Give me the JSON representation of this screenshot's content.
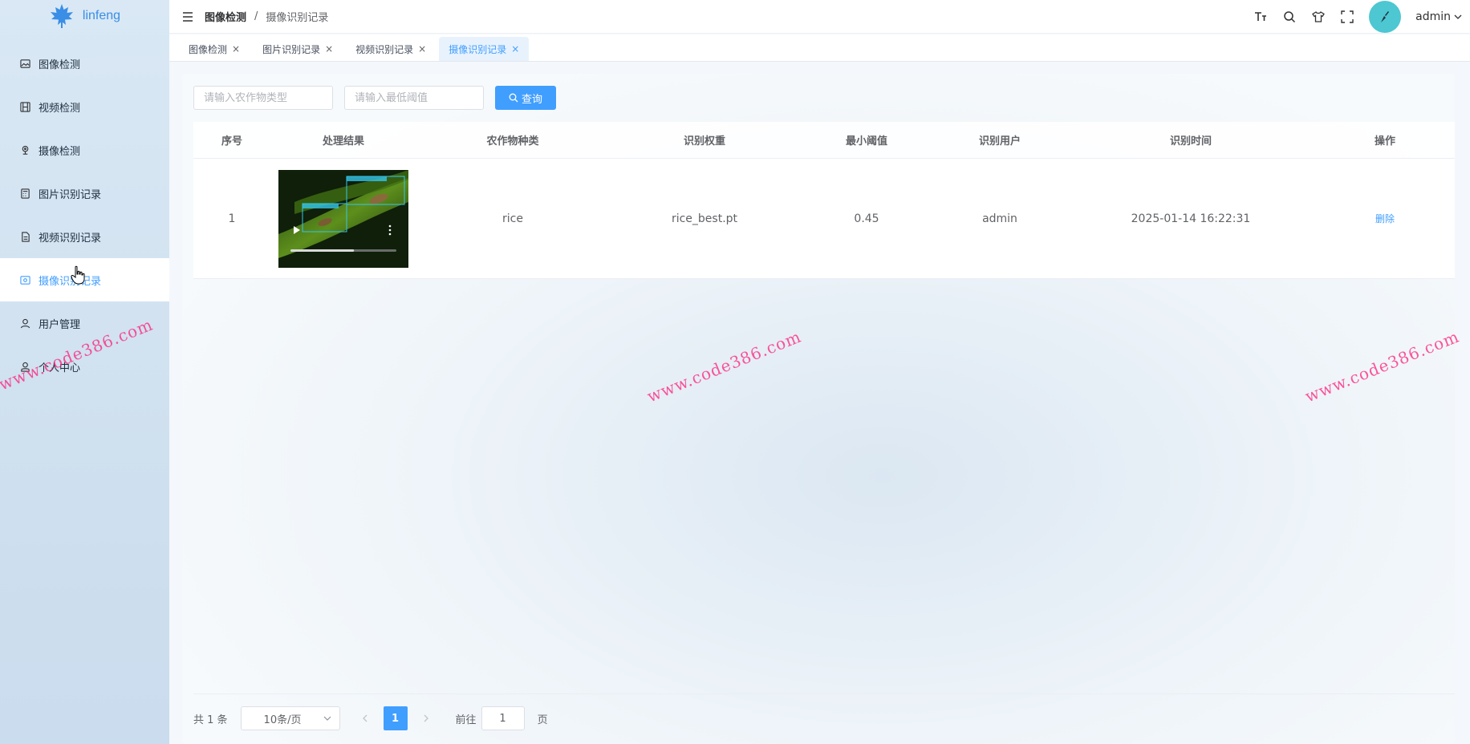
{
  "logo": {
    "text": "linfeng",
    "icon": "maple-leaf-icon"
  },
  "sidebar": {
    "items": [
      {
        "label": "图像检测",
        "icon": "image-icon"
      },
      {
        "label": "视频检测",
        "icon": "film-icon"
      },
      {
        "label": "摄像检测",
        "icon": "camera-icon"
      },
      {
        "label": "图片识别记录",
        "icon": "calculator-icon"
      },
      {
        "label": "视频识别记录",
        "icon": "document-icon"
      },
      {
        "label": "摄像识别记录",
        "icon": "picture-icon",
        "active": true
      },
      {
        "label": "用户管理",
        "icon": "user-icon"
      },
      {
        "label": "个人中心",
        "icon": "person-icon"
      }
    ]
  },
  "header": {
    "breadcrumb": [
      "图像检测",
      "摄像识别记录"
    ],
    "separator": "/",
    "icons": [
      "font-size-icon",
      "search-icon",
      "tshirt-icon",
      "fullscreen-icon"
    ],
    "user": "admin"
  },
  "tabs": [
    {
      "label": "图像检测",
      "close": "×"
    },
    {
      "label": "图片识别记录",
      "close": "×"
    },
    {
      "label": "视频识别记录",
      "close": "×"
    },
    {
      "label": "摄像识别记录",
      "close": "×",
      "active": true
    }
  ],
  "search": {
    "crop_placeholder": "请输入农作物类型",
    "threshold_placeholder": "请输入最低阈值",
    "query_label": "查询"
  },
  "table": {
    "columns": [
      "序号",
      "处理结果",
      "农作物种类",
      "识别权重",
      "最小阈值",
      "识别用户",
      "识别时间",
      "操作"
    ],
    "rows": [
      {
        "index": "1",
        "crop": "rice",
        "weight": "rice_best.pt",
        "threshold": "0.45",
        "user": "admin",
        "time": "2025-01-14 16:22:31",
        "action": "删除",
        "video_progress": 0.6
      }
    ]
  },
  "pagination": {
    "total": "共 1 条",
    "page_size": "10条/页",
    "current": "1",
    "goto_label": "前往",
    "goto_value": "1",
    "page_unit": "页"
  },
  "watermark": "www.code386.com",
  "colors": {
    "accent": "#409eff",
    "watermark": "#ff1e7a",
    "avatar": "#4dc7d1"
  }
}
